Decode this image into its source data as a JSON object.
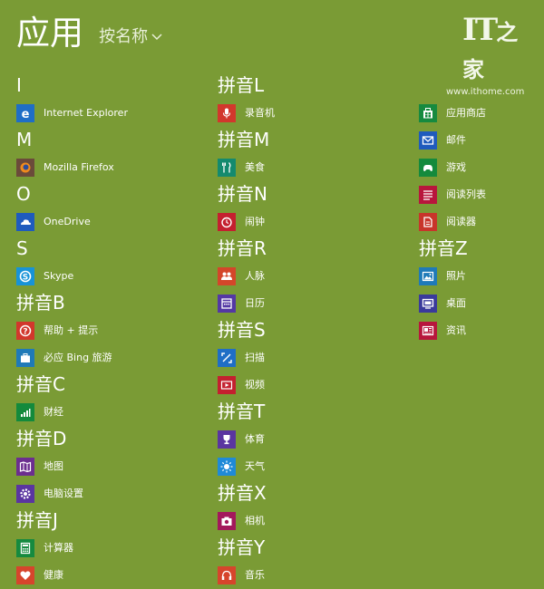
{
  "header": {
    "title": "应用",
    "sort_label": "按名称"
  },
  "watermark": {
    "logo": "IT",
    "logo_suffix": "之家",
    "url": "www.ithome.com"
  },
  "columns": [
    [
      {
        "type": "group",
        "label": "I"
      },
      {
        "type": "app",
        "name": "internet-explorer",
        "label": "Internet Explorer",
        "color": "#1f6ec6",
        "icon": "ie-icon"
      },
      {
        "type": "group",
        "label": "M"
      },
      {
        "type": "app",
        "name": "mozilla-firefox",
        "label": "Mozilla Firefox",
        "color": "#6b4a3a",
        "icon": "firefox-icon"
      },
      {
        "type": "group",
        "label": "O"
      },
      {
        "type": "app",
        "name": "onedrive",
        "label": "OneDrive",
        "color": "#1f5bbd",
        "icon": "cloud-icon"
      },
      {
        "type": "group",
        "label": "S"
      },
      {
        "type": "app",
        "name": "skype",
        "label": "Skype",
        "color": "#1793d8",
        "icon": "skype-icon"
      },
      {
        "type": "group",
        "label": "拼音B"
      },
      {
        "type": "app",
        "name": "help-tips",
        "label": "帮助 + 提示",
        "color": "#d2372c",
        "icon": "help-icon"
      },
      {
        "type": "app",
        "name": "bing-travel",
        "label": "必应 Bing 旅游",
        "color": "#1f7ab8",
        "icon": "suitcase-icon"
      },
      {
        "type": "group",
        "label": "拼音C"
      },
      {
        "type": "app",
        "name": "finance",
        "label": "财经",
        "color": "#138a3c",
        "icon": "finance-icon"
      },
      {
        "type": "group",
        "label": "拼音D"
      },
      {
        "type": "app",
        "name": "maps",
        "label": "地图",
        "color": "#6c2e8f",
        "icon": "map-icon"
      },
      {
        "type": "app",
        "name": "pc-settings",
        "label": "电脑设置",
        "color": "#5a35a0",
        "icon": "gear-icon"
      },
      {
        "type": "group",
        "label": "拼音J"
      },
      {
        "type": "app",
        "name": "calculator",
        "label": "计算器",
        "color": "#168a3f",
        "icon": "calculator-icon"
      },
      {
        "type": "app",
        "name": "health",
        "label": "健康",
        "color": "#d6452c",
        "icon": "health-icon"
      }
    ],
    [
      {
        "type": "group",
        "label": "拼音L"
      },
      {
        "type": "app",
        "name": "sound-recorder",
        "label": "录音机",
        "color": "#d2372c",
        "icon": "microphone-icon"
      },
      {
        "type": "group",
        "label": "拼音M"
      },
      {
        "type": "app",
        "name": "food",
        "label": "美食",
        "color": "#148a6e",
        "icon": "food-icon"
      },
      {
        "type": "group",
        "label": "拼音N"
      },
      {
        "type": "app",
        "name": "alarms",
        "label": "闹钟",
        "color": "#c4202f",
        "icon": "alarm-icon"
      },
      {
        "type": "group",
        "label": "拼音R"
      },
      {
        "type": "app",
        "name": "people",
        "label": "人脉",
        "color": "#d4462a",
        "icon": "people-icon"
      },
      {
        "type": "app",
        "name": "calendar",
        "label": "日历",
        "color": "#5438a4",
        "icon": "calendar-icon"
      },
      {
        "type": "group",
        "label": "拼音S"
      },
      {
        "type": "app",
        "name": "scan",
        "label": "扫描",
        "color": "#1f6ec6",
        "icon": "scan-icon"
      },
      {
        "type": "app",
        "name": "video",
        "label": "视频",
        "color": "#c4202f",
        "icon": "video-icon"
      },
      {
        "type": "group",
        "label": "拼音T"
      },
      {
        "type": "app",
        "name": "sports",
        "label": "体育",
        "color": "#5a35a0",
        "icon": "trophy-icon"
      },
      {
        "type": "app",
        "name": "weather",
        "label": "天气",
        "color": "#1f8ad8",
        "icon": "sun-icon"
      },
      {
        "type": "group",
        "label": "拼音X"
      },
      {
        "type": "app",
        "name": "camera",
        "label": "相机",
        "color": "#a3185c",
        "icon": "camera-icon"
      },
      {
        "type": "group",
        "label": "拼音Y"
      },
      {
        "type": "app",
        "name": "music",
        "label": "音乐",
        "color": "#d6452c",
        "icon": "headphones-icon"
      }
    ],
    [
      {
        "type": "spacer"
      },
      {
        "type": "app",
        "name": "store",
        "label": "应用商店",
        "color": "#168a3f",
        "icon": "store-icon"
      },
      {
        "type": "app",
        "name": "mail",
        "label": "邮件",
        "color": "#1f5bbd",
        "icon": "mail-icon"
      },
      {
        "type": "app",
        "name": "games",
        "label": "游戏",
        "color": "#148a3c",
        "icon": "gamepad-icon"
      },
      {
        "type": "app",
        "name": "reading-list",
        "label": "阅读列表",
        "color": "#b8163c",
        "icon": "reading-list-icon"
      },
      {
        "type": "app",
        "name": "reader",
        "label": "阅读器",
        "color": "#c8352a",
        "icon": "reader-icon"
      },
      {
        "type": "group",
        "label": "拼音Z"
      },
      {
        "type": "app",
        "name": "photos",
        "label": "照片",
        "color": "#1f7ab8",
        "icon": "photo-icon"
      },
      {
        "type": "app",
        "name": "desktop",
        "label": "桌面",
        "color": "#3a3a9c",
        "icon": "desktop-icon"
      },
      {
        "type": "app",
        "name": "news",
        "label": "资讯",
        "color": "#b8163c",
        "icon": "news-icon"
      }
    ]
  ]
}
